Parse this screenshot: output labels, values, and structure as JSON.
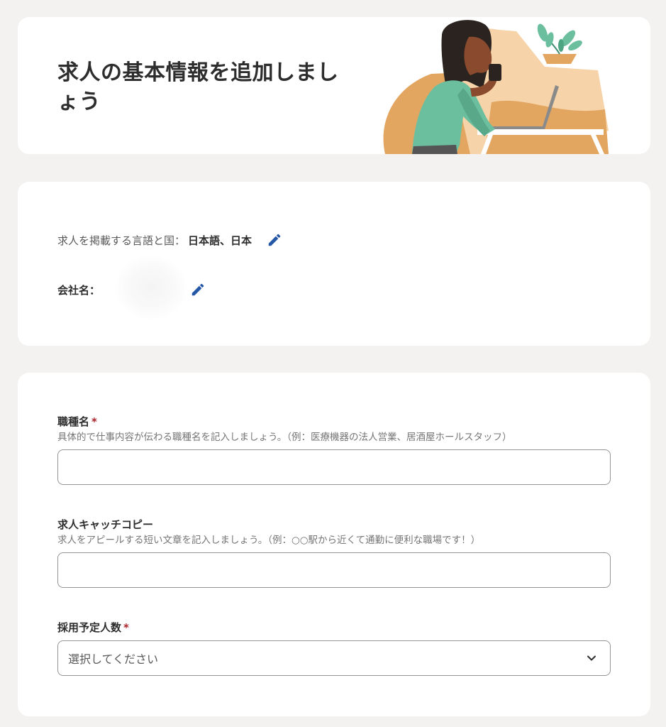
{
  "header": {
    "title": "求人の基本情報を追加しましょう"
  },
  "info": {
    "language_label": "求人を掲載する言語と国：",
    "language_value": "日本語、日本",
    "company_label": "会社名："
  },
  "form": {
    "job_title": {
      "label": "職種名",
      "required_mark": "*",
      "hint": "具体的で仕事内容が伝わる職種名を記入しましょう。（例：医療機器の法人営業、居酒屋ホールスタッフ）",
      "value": ""
    },
    "catch_copy": {
      "label": "求人キャッチコピー",
      "hint": "求人をアピールする短い文章を記入しましょう。（例：○○駅から近くて通勤に便利な職場です！）",
      "value": ""
    },
    "hire_count": {
      "label": "採用予定人数",
      "required_mark": "*",
      "selected": "選択してください"
    }
  },
  "colors": {
    "background": "#f3f2f1",
    "card": "#ffffff",
    "accent_blue": "#2557a7",
    "required_red": "#a9252b",
    "illustration_orange": "#e3a661",
    "illustration_peach": "#f6d3a8",
    "illustration_green": "#6cbf9e"
  },
  "icons": [
    "pencil-icon",
    "chevron-down-icon"
  ]
}
